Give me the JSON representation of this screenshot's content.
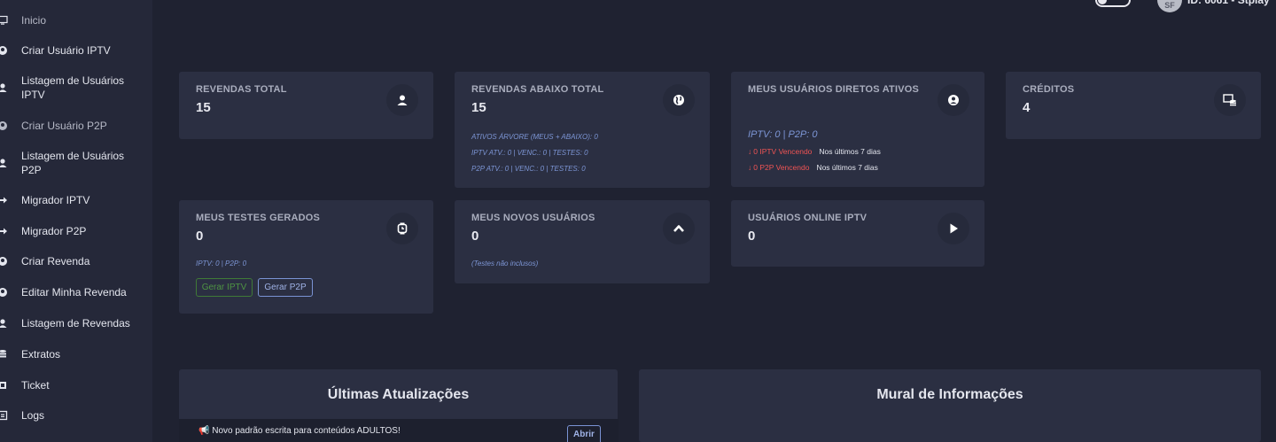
{
  "topbar": {
    "avatar_initials": "SF",
    "user_id": "ID: 6061 - Stplay"
  },
  "sidebar": {
    "items": [
      {
        "label": "Inicio",
        "icon": "monitor-icon"
      },
      {
        "label": "Criar Usuário IPTV",
        "icon": "user-plus-icon"
      },
      {
        "label": "Listagem de Usuários IPTV",
        "icon": "user-icon"
      },
      {
        "label": "Criar Usuário P2P",
        "icon": "user-plus-icon"
      },
      {
        "label": "Listagem de Usuários P2P",
        "icon": "user-icon"
      },
      {
        "label": "Migrador IPTV",
        "icon": "arrow-right-icon"
      },
      {
        "label": "Migrador P2P",
        "icon": "arrow-right-icon"
      },
      {
        "label": "Criar Revenda",
        "icon": "user-plus-icon"
      },
      {
        "label": "Editar Minha Revenda",
        "icon": "user-edit-icon"
      },
      {
        "label": "Listagem de Revendas",
        "icon": "user-icon"
      },
      {
        "label": "Extratos",
        "icon": "database-icon"
      },
      {
        "label": "Ticket",
        "icon": "ticket-icon"
      },
      {
        "label": "Logs",
        "icon": "log-icon"
      }
    ]
  },
  "cards": {
    "revendas_total": {
      "title": "REVENDAS TOTAL",
      "value": "15"
    },
    "revendas_abaixo": {
      "title": "REVENDAS ABAIXO TOTAL",
      "value": "15",
      "line1": "ATIVOS ÁRVORE (MEUS + ABAIXO): 0",
      "line2": "IPTV ATV.: 0 | VENC.: 0 | TESTES: 0",
      "line3": "P2P ATV.: 0 | VENC.: 0 | TESTES: 0"
    },
    "meus_diretos": {
      "title": "MEUS USUÁRIOS DIRETOS ATIVOS",
      "sub": "IPTV: 0 | P2P: 0",
      "iptv_venc": "0 IPTV Vencendo",
      "p2p_venc": "0 P2P Vencendo",
      "period": "Nos últimos 7 dias"
    },
    "creditos": {
      "title": "CRÉDITOS",
      "value": "4"
    },
    "testes": {
      "title": "MEUS TESTES GERADOS",
      "value": "0",
      "sub": "IPTV: 0 | P2P: 0",
      "btn_iptv": "Gerar IPTV",
      "btn_p2p": "Gerar P2P"
    },
    "novos": {
      "title": "MEUS NOVOS USUÁRIOS",
      "value": "0",
      "sub": "(Testes não inclusos)"
    },
    "online": {
      "title": "USUÁRIOS ONLINE IPTV",
      "value": "0"
    }
  },
  "panels": {
    "updates": {
      "title": "Últimas Atualizações",
      "item_text": "Novo padrão escrita para conteúdos ADULTOS!",
      "item_button": "Abrir"
    },
    "mural": {
      "title": "Mural de Informações"
    }
  },
  "colors": {
    "background": "#1f2231",
    "card": "#2b2f42",
    "accent_blue": "#7d96d6",
    "danger": "#f05454",
    "success": "#4e9443"
  }
}
